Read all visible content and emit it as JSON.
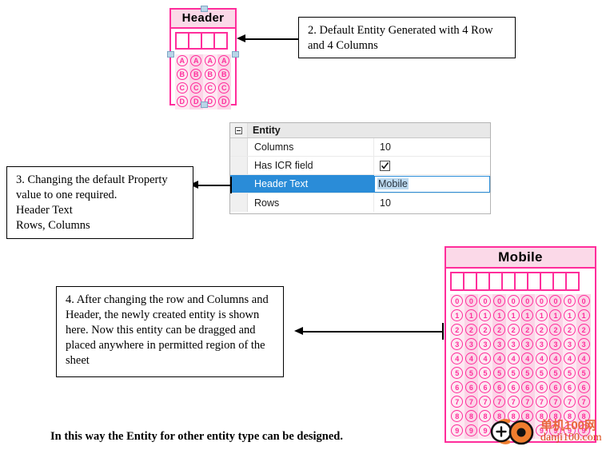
{
  "entity_default": {
    "header_text": "Header",
    "columns": 4,
    "rows": 4,
    "row_labels": [
      "A",
      "B",
      "C",
      "D"
    ],
    "selected": true,
    "border_color": "#ff2d9b",
    "header_fill": "#fbd9e8"
  },
  "entity_mobile": {
    "header_text": "Mobile",
    "columns": 10,
    "rows": 10,
    "row_labels": [
      "0",
      "1",
      "2",
      "3",
      "4",
      "5",
      "6",
      "7",
      "8",
      "9"
    ],
    "selected": false,
    "border_color": "#ff2d9b",
    "header_fill": "#fbd9e8"
  },
  "property_grid": {
    "group_label": "Entity",
    "rows": [
      {
        "name": "Columns",
        "value": "10",
        "type": "text",
        "selected": false
      },
      {
        "name": "Has ICR field",
        "value": "true",
        "type": "checkbox",
        "selected": false
      },
      {
        "name": "Header Text",
        "value": "Mobile",
        "type": "editing",
        "selected": true
      },
      {
        "name": "Rows",
        "value": "10",
        "type": "text",
        "selected": false
      }
    ]
  },
  "callouts": {
    "note2": "2. Default Entity Generated with 4 Row and 4 Columns",
    "note3_line1": "3. Changing the default Property value to one required.",
    "note3_line2": "Header Text",
    "note3_line3": "Rows, Columns",
    "note4": "4. After changing the row and Columns and Header, the newly created entity is shown here. Now this entity can be dragged and placed anywhere in permitted region of the sheet"
  },
  "caption": "In this way the Entity for other entity type can be designed.",
  "watermark": {
    "cn_text": "单机100网",
    "url_text": "danji100.com",
    "accent": "#ef7d2e"
  }
}
